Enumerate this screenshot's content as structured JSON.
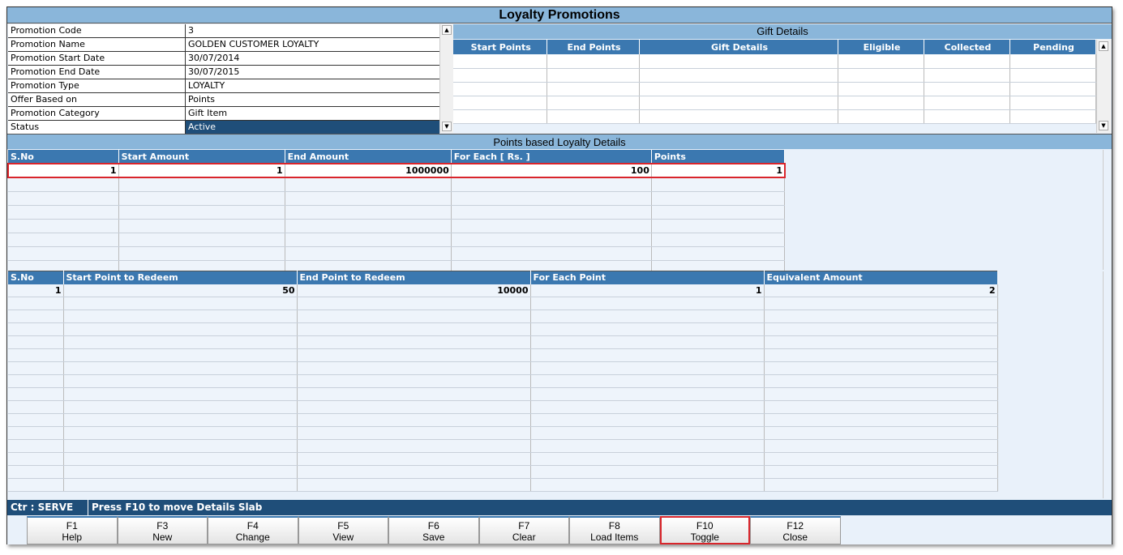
{
  "title": "Loyalty Promotions",
  "form": [
    {
      "label": "Promotion Code",
      "value": "3"
    },
    {
      "label": "Promotion Name",
      "value": "GOLDEN CUSTOMER LOYALTY"
    },
    {
      "label": "Promotion Start Date",
      "value": "30/07/2014"
    },
    {
      "label": "Promotion End Date",
      "value": "30/07/2015"
    },
    {
      "label": "Promotion Type",
      "value": "LOYALTY"
    },
    {
      "label": "Offer Based on",
      "value": "Points"
    },
    {
      "label": "Promotion Category",
      "value": "Gift Item"
    },
    {
      "label": "Status",
      "value": "Active"
    }
  ],
  "gift": {
    "title": "Gift Details",
    "columns": [
      "Start Points",
      "End Points",
      "Gift Details",
      "Eligible",
      "Collected",
      "Pending"
    ]
  },
  "points": {
    "title": "Points based Loyalty Details",
    "columns": [
      "S.No",
      "Start Amount",
      "End Amount",
      "For Each [ Rs. ]",
      "Points"
    ],
    "rows": [
      [
        "1",
        "1",
        "1000000",
        "100",
        "1"
      ]
    ]
  },
  "redeem": {
    "columns": [
      "S.No",
      "Start Point to Redeem",
      "End Point to Redeem",
      "For Each Point",
      "Equivalent Amount"
    ],
    "rows": [
      [
        "1",
        "50",
        "10000",
        "1",
        "2"
      ]
    ]
  },
  "status": {
    "counter": "Ctr : SERVE",
    "message": "Press F10 to move Details Slab"
  },
  "buttons": [
    {
      "key": "F1",
      "label": "Help"
    },
    {
      "key": "F3",
      "label": "New"
    },
    {
      "key": "F4",
      "label": "Change"
    },
    {
      "key": "F5",
      "label": "View"
    },
    {
      "key": "F6",
      "label": "Save"
    },
    {
      "key": "F7",
      "label": "Clear"
    },
    {
      "key": "F8",
      "label": "Load Items"
    },
    {
      "key": "F10",
      "label": "Toggle"
    },
    {
      "key": "F12",
      "label": "Close"
    }
  ]
}
